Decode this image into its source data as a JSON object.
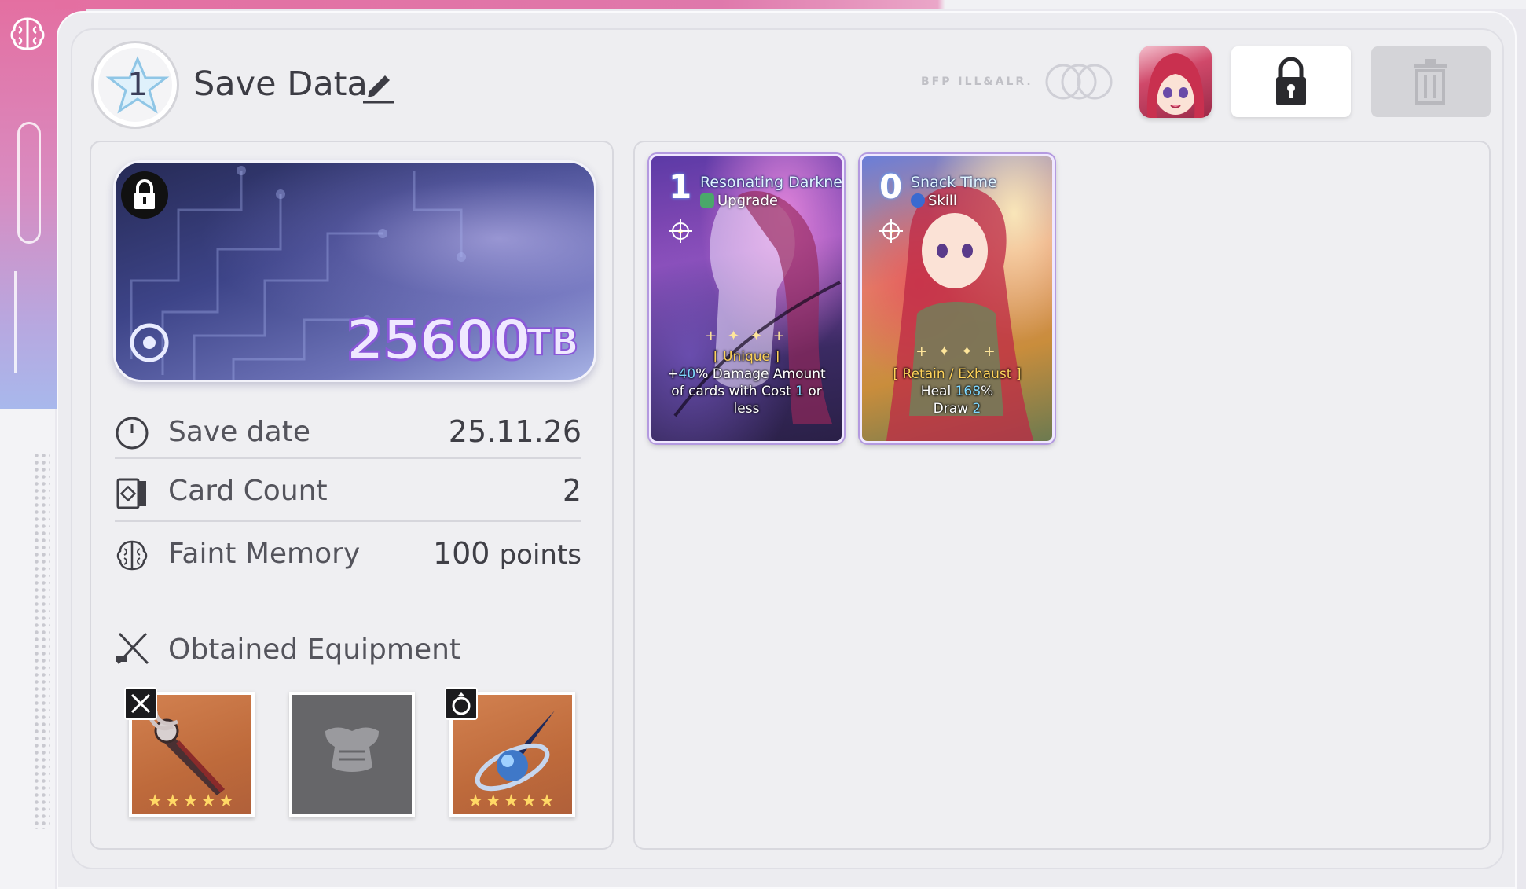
{
  "header": {
    "slot_number": "1",
    "title": "Save Data",
    "deco_text": "BFP ILL&ALR."
  },
  "storage": {
    "value": "25600",
    "unit": "TB"
  },
  "stats": [
    {
      "icon": "clock-icon",
      "label": "Save date",
      "value": "25.11.26"
    },
    {
      "icon": "card-count-icon",
      "label": "Card Count",
      "value": "2"
    },
    {
      "icon": "brain-icon",
      "label": "Faint Memory",
      "value_number": "100",
      "value_unit": "points"
    }
  ],
  "equipment": {
    "title": "Obtained Equipment",
    "slots": [
      {
        "type_icon": "sword-icon",
        "item": "dagger",
        "stars": "★★★★★",
        "state": "filled"
      },
      {
        "type_icon": "armor-icon",
        "item": "empty-armor",
        "stars": "",
        "state": "empty"
      },
      {
        "type_icon": "ring-icon",
        "item": "orb-dagger",
        "stars": "★★★★★",
        "state": "filled"
      }
    ]
  },
  "cards": [
    {
      "cost": "1",
      "name": "Resonating Darkness",
      "type": "Upgrade",
      "stars": "+ ✦ ✦ +",
      "tag": "[ Unique ]",
      "desc_line1_pre": "+",
      "desc_line1_hl": "40",
      "desc_line1_post": "% Damage Amount",
      "desc_line2_pre": "of cards with Cost ",
      "desc_line2_hl": "1",
      "desc_line2_post": " or",
      "desc_line3": "less"
    },
    {
      "cost": "0",
      "name": "Snack Time",
      "type": "Skill",
      "stars": "+ ✦ ✦ +",
      "tag": "[ Retain / Exhaust ]",
      "heal_pre": "Heal ",
      "heal_hl": "168",
      "heal_post": "%",
      "draw_pre": "Draw ",
      "draw_hl": "2"
    }
  ],
  "colors": {
    "accent_pink": "#e46fa1",
    "storage_purple": "#8a58d8",
    "star_gold": "#ffd865",
    "highlight_blue": "#7fd8ff",
    "tag_gold": "#ffd35a"
  }
}
